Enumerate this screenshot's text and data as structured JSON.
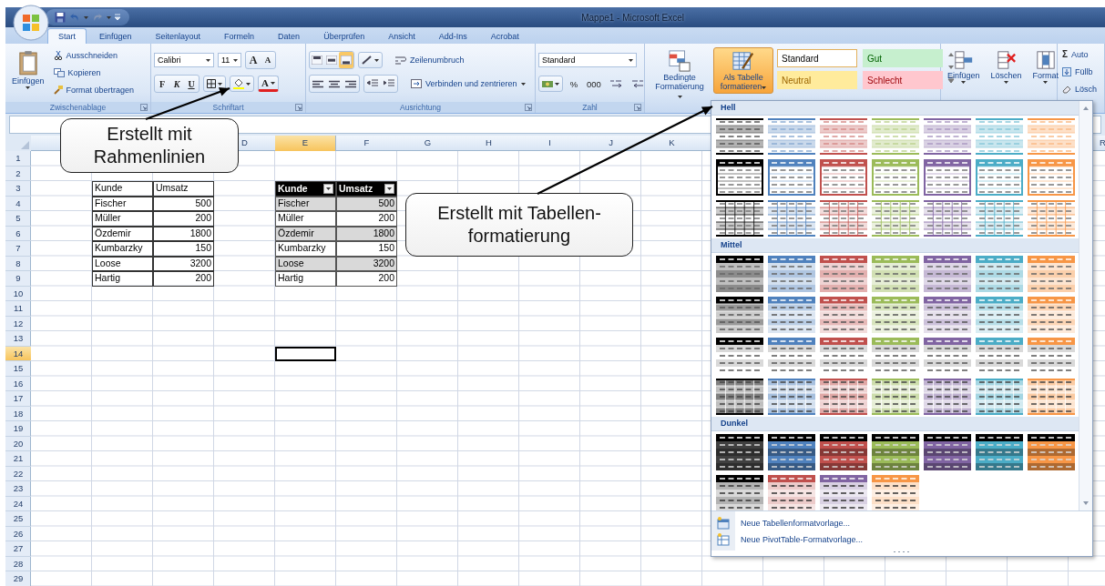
{
  "window": {
    "title": "Mappe1 - Microsoft Excel"
  },
  "ribbon_tabs": [
    {
      "label": "Start",
      "selected": true
    },
    {
      "label": "Einfügen",
      "selected": false
    },
    {
      "label": "Seitenlayout",
      "selected": false
    },
    {
      "label": "Formeln",
      "selected": false
    },
    {
      "label": "Daten",
      "selected": false
    },
    {
      "label": "Überprüfen",
      "selected": false
    },
    {
      "label": "Ansicht",
      "selected": false
    },
    {
      "label": "Add-Ins",
      "selected": false
    },
    {
      "label": "Acrobat",
      "selected": false
    }
  ],
  "clipboard": {
    "paste": "Einfügen",
    "cut": "Ausschneiden",
    "copy": "Kopieren",
    "format_painter": "Format übertragen",
    "label": "Zwischenablage"
  },
  "font": {
    "family": "Calibri",
    "size": "11",
    "grow": "A",
    "shrink": "A",
    "bold": "F",
    "italic": "K",
    "underline": "U",
    "font_tint": "A",
    "label": "Schriftart"
  },
  "alignment": {
    "vertical": [
      {
        "selected": false
      },
      {
        "selected": false
      },
      {
        "selected": true
      }
    ],
    "wrap": "Zeilenumbruch",
    "merge": "Verbinden und zentrieren",
    "label": "Ausrichtung"
  },
  "number": {
    "format": "Standard",
    "percent": "%",
    "thousands": "000",
    "label": "Zahl"
  },
  "styles": {
    "conditional": "Bedingte Formatierung",
    "format_as_table": {
      "label": "Als Tabelle formatieren",
      "selected": true
    },
    "cell_styles": [
      {
        "label": "Standard",
        "kind": "normal"
      },
      {
        "label": "Gut",
        "kind": "good"
      },
      {
        "label": "Neutral",
        "kind": "neutral"
      },
      {
        "label": "Schlecht",
        "kind": "bad"
      }
    ]
  },
  "cells": {
    "buttons": [
      {
        "kind": "insert",
        "label": "Einfügen"
      },
      {
        "kind": "delete",
        "label": "Löschen"
      },
      {
        "kind": "format",
        "label": "Format"
      }
    ]
  },
  "editing": [
    {
      "kind": "autosum",
      "glyph": "Σ",
      "label": "Auto"
    },
    {
      "kind": "fill",
      "label": "Füllb"
    },
    {
      "kind": "clear",
      "label": "Lösch"
    }
  ],
  "columns": [
    {
      "label": "D",
      "selected": false
    },
    {
      "label": "E",
      "selected": true
    },
    {
      "label": "F",
      "selected": false
    },
    {
      "label": "G",
      "selected": false
    },
    {
      "label": "H",
      "selected": false
    },
    {
      "label": "I",
      "selected": false
    },
    {
      "label": "J",
      "selected": false
    },
    {
      "label": "K",
      "selected": false
    },
    {
      "label": "R",
      "selected": false
    }
  ],
  "rows": [
    {
      "label": "1",
      "selected": false
    },
    {
      "label": "2",
      "selected": false
    },
    {
      "label": "3",
      "selected": false
    },
    {
      "label": "4",
      "selected": false
    },
    {
      "label": "5",
      "selected": false
    },
    {
      "label": "6",
      "selected": false
    },
    {
      "label": "7",
      "selected": false
    },
    {
      "label": "8",
      "selected": false
    },
    {
      "label": "9",
      "selected": false
    },
    {
      "label": "10",
      "selected": false
    },
    {
      "label": "11",
      "selected": false
    },
    {
      "label": "12",
      "selected": false
    },
    {
      "label": "13",
      "selected": false
    },
    {
      "label": "14",
      "selected": true
    },
    {
      "label": "15",
      "selected": false
    },
    {
      "label": "16",
      "selected": false
    },
    {
      "label": "17",
      "selected": false
    },
    {
      "label": "18",
      "selected": false
    },
    {
      "label": "19",
      "selected": false
    },
    {
      "label": "20",
      "selected": false
    },
    {
      "label": "21",
      "selected": false
    },
    {
      "label": "22",
      "selected": false
    },
    {
      "label": "23",
      "selected": false
    },
    {
      "label": "24",
      "selected": false
    },
    {
      "label": "25",
      "selected": false
    },
    {
      "label": "26",
      "selected": false
    },
    {
      "label": "27",
      "selected": false
    },
    {
      "label": "28",
      "selected": false
    },
    {
      "label": "29",
      "selected": false
    }
  ],
  "bordered_table": {
    "header": [
      "Kunde",
      "Umsatz"
    ],
    "rows": [
      [
        "Fischer",
        "500"
      ],
      [
        "Müller",
        "200"
      ],
      [
        "Özdemir",
        "1800"
      ],
      [
        "Kumbarzky",
        "150"
      ],
      [
        "Loose",
        "3200"
      ],
      [
        "Hartig",
        "200"
      ]
    ]
  },
  "formatted_table": {
    "header": [
      "Kunde",
      "Umsatz"
    ],
    "rows": [
      {
        "cells": [
          "Fischer",
          "500"
        ],
        "shaded": true
      },
      {
        "cells": [
          "Müller",
          "200"
        ],
        "shaded": false
      },
      {
        "cells": [
          "Özdemir",
          "1800"
        ],
        "shaded": true
      },
      {
        "cells": [
          "Kumbarzky",
          "150"
        ],
        "shaded": false
      },
      {
        "cells": [
          "Loose",
          "3200"
        ],
        "shaded": true
      },
      {
        "cells": [
          "Hartig",
          "200"
        ],
        "shaded": false
      }
    ]
  },
  "style_gallery": {
    "sections": [
      {
        "title": "Hell",
        "rows": [
          {
            "kind": "light",
            "swatches": [
              {
                "color": "#000000"
              },
              {
                "color": "#4f81bd"
              },
              {
                "color": "#c0504d"
              },
              {
                "color": "#9bbb59"
              },
              {
                "color": "#8064a2"
              },
              {
                "color": "#4bacc6"
              },
              {
                "color": "#f79646"
              }
            ]
          },
          {
            "kind": "header",
            "swatches": [
              {
                "color": "#000000"
              },
              {
                "color": "#4f81bd"
              },
              {
                "color": "#c0504d"
              },
              {
                "color": "#9bbb59"
              },
              {
                "color": "#8064a2"
              },
              {
                "color": "#4bacc6"
              },
              {
                "color": "#f79646"
              }
            ]
          },
          {
            "kind": "grid",
            "swatches": [
              {
                "color": "#000000"
              },
              {
                "color": "#4f81bd"
              },
              {
                "color": "#c0504d"
              },
              {
                "color": "#9bbb59"
              },
              {
                "color": "#8064a2"
              },
              {
                "color": "#4bacc6"
              },
              {
                "color": "#f79646"
              }
            ]
          }
        ]
      },
      {
        "title": "Mittel",
        "rows": [
          {
            "kind": "medium-header",
            "swatches": [
              {
                "color": "#000000"
              },
              {
                "color": "#4f81bd"
              },
              {
                "color": "#c0504d"
              },
              {
                "color": "#9bbb59"
              },
              {
                "color": "#8064a2"
              },
              {
                "color": "#4bacc6"
              },
              {
                "color": "#f79646"
              }
            ]
          },
          {
            "kind": "medium-banded",
            "swatches": [
              {
                "color": "#000000"
              },
              {
                "color": "#4f81bd"
              },
              {
                "color": "#c0504d"
              },
              {
                "color": "#9bbb59"
              },
              {
                "color": "#8064a2"
              },
              {
                "color": "#4bacc6"
              },
              {
                "color": "#f79646"
              }
            ]
          },
          {
            "kind": "medium-lines",
            "swatches": [
              {
                "color": "#000000"
              },
              {
                "color": "#4f81bd"
              },
              {
                "color": "#c0504d"
              },
              {
                "color": "#9bbb59"
              },
              {
                "color": "#8064a2"
              },
              {
                "color": "#4bacc6"
              },
              {
                "color": "#f79646"
              }
            ]
          },
          {
            "kind": "medium-grid",
            "swatches": [
              {
                "color": "#000000"
              },
              {
                "color": "#4f81bd"
              },
              {
                "color": "#c0504d"
              },
              {
                "color": "#9bbb59"
              },
              {
                "color": "#8064a2"
              },
              {
                "color": "#4bacc6"
              },
              {
                "color": "#f79646"
              }
            ]
          }
        ]
      },
      {
        "title": "Dunkel",
        "rows": [
          {
            "kind": "dark",
            "swatches": [
              {
                "color": "#404040"
              },
              {
                "color": "#4f81bd"
              },
              {
                "color": "#c0504d"
              },
              {
                "color": "#9bbb59"
              },
              {
                "color": "#8064a2"
              },
              {
                "color": "#4bacc6"
              },
              {
                "color": "#f79646"
              }
            ]
          },
          {
            "kind": "dark-light",
            "swatches": [
              {
                "color": "#000000"
              },
              {
                "color": "#c0504d"
              },
              {
                "color": "#8064a2"
              },
              {
                "color": "#f79646"
              }
            ]
          }
        ]
      }
    ],
    "menu_items": [
      {
        "kind": "table",
        "label": "Neue Tabellenformatvorlage..."
      },
      {
        "kind": "pivot",
        "label": "Neue PivotTable-Formatvorlage..."
      }
    ]
  },
  "callouts": [
    {
      "lines": [
        "Erstellt mit",
        "Rahmenlinien"
      ]
    },
    {
      "lines": [
        "Erstellt mit Tabellen-",
        "formatierung"
      ]
    }
  ]
}
